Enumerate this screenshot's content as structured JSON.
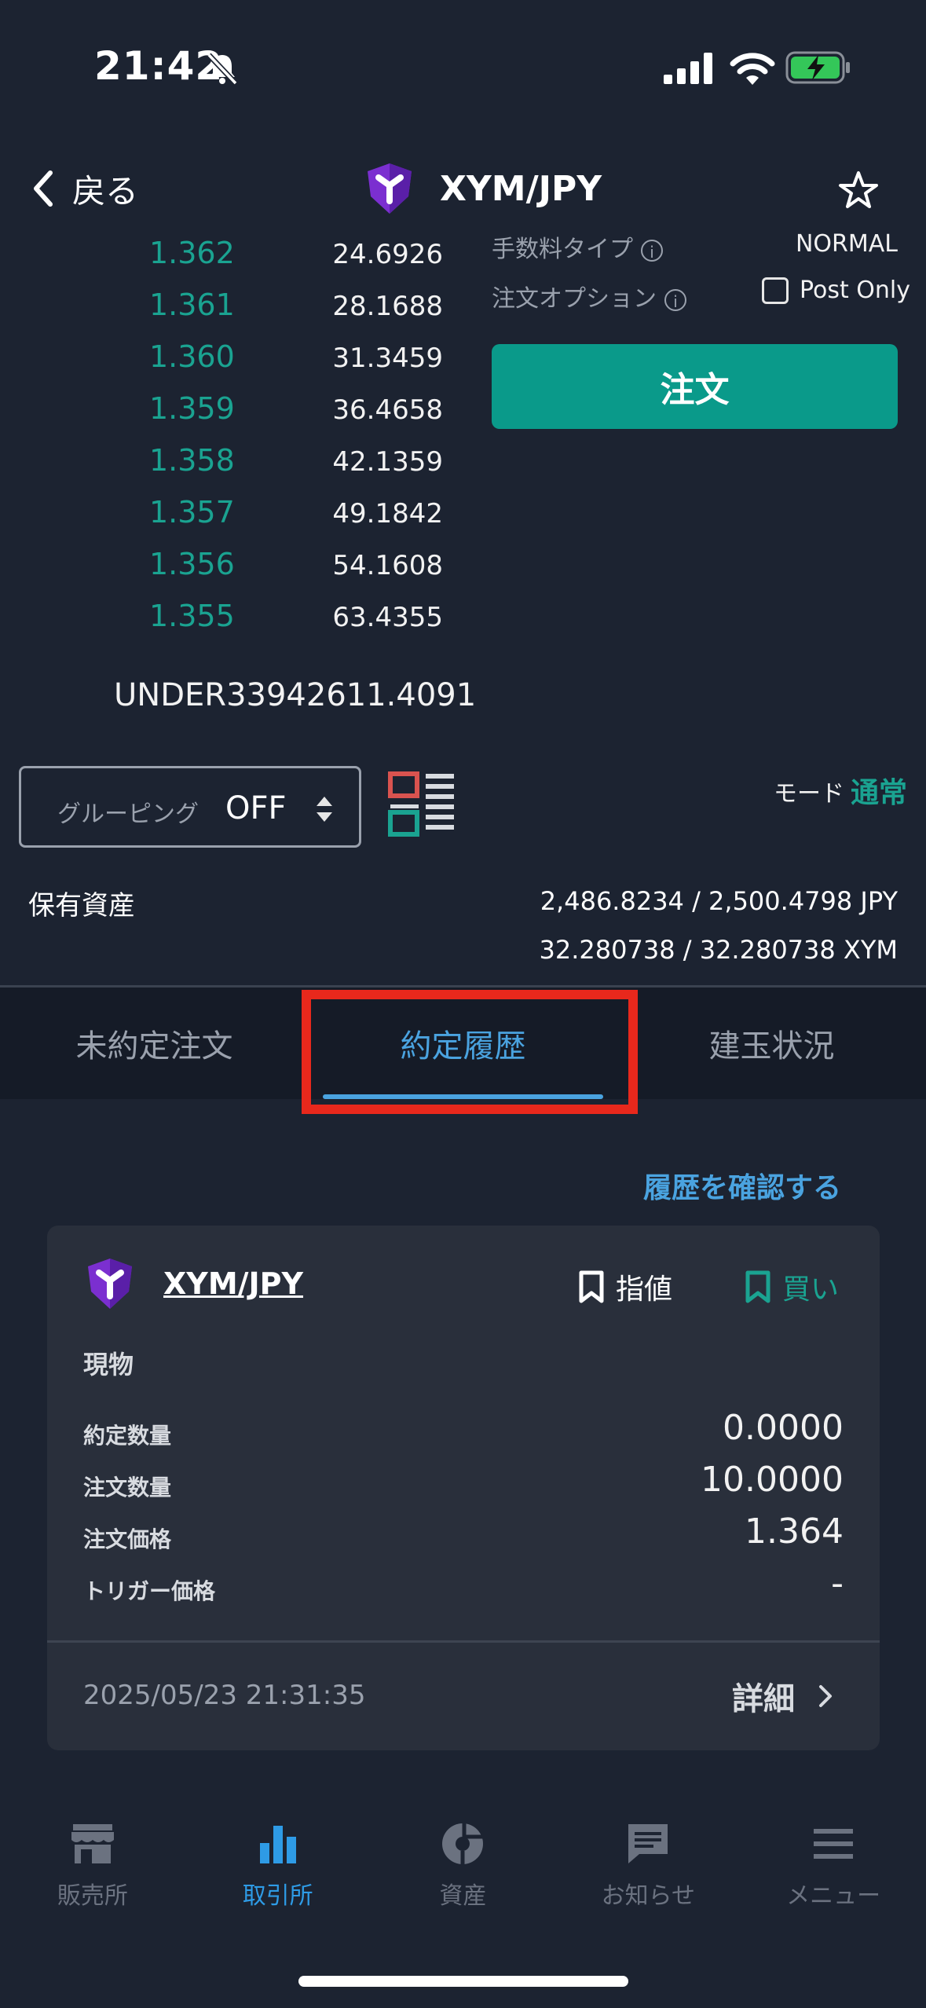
{
  "status_bar": {
    "time": "21:42"
  },
  "header": {
    "back_label": "戻る",
    "pair": "XYM/JPY"
  },
  "order_book": {
    "rows": [
      {
        "price": "1.362",
        "qty": "24.6926"
      },
      {
        "price": "1.361",
        "qty": "28.1688"
      },
      {
        "price": "1.360",
        "qty": "31.3459"
      },
      {
        "price": "1.359",
        "qty": "36.4658"
      },
      {
        "price": "1.358",
        "qty": "42.1359"
      },
      {
        "price": "1.357",
        "qty": "49.1842"
      },
      {
        "price": "1.356",
        "qty": "54.1608"
      },
      {
        "price": "1.355",
        "qty": "63.4355"
      }
    ],
    "under": "UNDER33942611.4091"
  },
  "order_panel": {
    "fee_label": "手数料タイプ",
    "fee_value": "NORMAL",
    "option_label": "注文オプション",
    "post_only_label": "Post Only",
    "order_button": "注文"
  },
  "grouping": {
    "label": "グルーピング",
    "value": "OFF"
  },
  "mode": {
    "label": "モード",
    "value": "通常"
  },
  "holdings": {
    "label": "保有資産",
    "jpy": "2,486.8234 / 2,500.4798  JPY",
    "xym": "32.280738 / 32.280738  XYM"
  },
  "tabs": [
    {
      "label": "未約定注文"
    },
    {
      "label": "約定履歴"
    },
    {
      "label": "建玉状況"
    }
  ],
  "history_link": "履歴を確認する",
  "card": {
    "pair": "XYM/JPY",
    "order_type": "指値",
    "side": "買い",
    "kind": "現物",
    "rows": [
      {
        "label": "約定数量",
        "value": "0.0000"
      },
      {
        "label": "注文数量",
        "value": "10.0000"
      },
      {
        "label": "注文価格",
        "value": "1.364"
      },
      {
        "label": "トリガー価格",
        "value": "-"
      }
    ],
    "date": "2025/05/23 21:31:35",
    "detail_label": "詳細"
  },
  "bottom_nav": [
    {
      "label": "販売所",
      "icon": "store-icon"
    },
    {
      "label": "取引所",
      "icon": "bar-chart-icon"
    },
    {
      "label": "資産",
      "icon": "pie-chart-icon"
    },
    {
      "label": "お知らせ",
      "icon": "message-icon"
    },
    {
      "label": "メニュー",
      "icon": "menu-icon"
    }
  ],
  "colors": {
    "accent": "#0a9a8a",
    "tab_active": "#4aa3e0",
    "highlight": "#e8281c",
    "background": "#1c2331"
  }
}
